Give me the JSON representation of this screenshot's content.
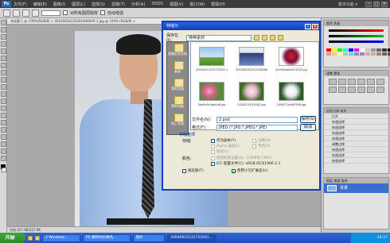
{
  "menubar": {
    "logo": "Ps",
    "items": [
      "文件(F)",
      "编辑(E)",
      "图像(I)",
      "图层(L)",
      "选择(S)",
      "滤镜(T)",
      "分析(A)",
      "3D(D)",
      "视图(V)",
      "窗口(W)",
      "帮助(H)"
    ],
    "workspace": "基本功能 ▾",
    "min": "–",
    "max": "□",
    "close": "×"
  },
  "optbar": {
    "check1_label": "对所有图层取样",
    "check2_label": "自动增强"
  },
  "document": {
    "tab_title": "未标题-1 @ 100%(RGB/8) ×  20030818132201646640-1.jpg @ 100% (RGB/8) ×"
  },
  "statusbar": {
    "text": "文档:327.9K/327.9K"
  },
  "panels": {
    "color_title": "颜色  色板",
    "adjust_title": "调整  蒙版",
    "history_title": "历史记录  动作",
    "history_items": [
      "打开",
      "快速选择",
      "快速选择",
      "快速选择",
      "快速选择",
      "调整边缘",
      "快速选择",
      "快速选择",
      "快速选择"
    ],
    "layers_title": "图层  通道  路径",
    "layer_name": "背景",
    "swatch_colors": [
      "#ff0000",
      "#ffff00",
      "#00ff00",
      "#00ffff",
      "#0000ff",
      "#ff00ff",
      "#ffffff",
      "#cccccc",
      "#999999",
      "#666666",
      "#333333",
      "#000000",
      "#f7977a",
      "#fdc68a",
      "#fff79a",
      "#a2d39c",
      "#6dcff6",
      "#8493ca",
      "#a187be",
      "#f49ac2",
      "#c7b299",
      "#998675",
      "#736357",
      "#534741"
    ]
  },
  "dialog": {
    "title": "存储为",
    "help": "?",
    "close": "×",
    "save_in_label": "保存在(I):",
    "save_in_value": "特种素材",
    "places": [
      "我最近的文档",
      "桌面",
      "我的文档",
      "我的电脑",
      "网上邻居"
    ],
    "files": [
      "20040910135752041.jpg",
      "20030818132201646640-1.jpg",
      "42a93cb6dd1f1020.jpg",
      "3ba5b9c4ea0d8.jpg",
      "2004101813482.jpg",
      "2094f71ea8f7f98.jpg"
    ],
    "filename_label": "文件名(N):",
    "filename_value": "2.psd",
    "format_label": "格式(F):",
    "format_value": "JPEG (*.JPG;*.JPEG;*.JPE)",
    "save_button": "保存(S)",
    "cancel_button": "取消",
    "options_header": "存储选项",
    "save_group": "存储:",
    "opt_copy": "作为副本(Y)",
    "opt_notes": "注释(N)",
    "opt_alpha": "Alpha 通道(E)",
    "opt_spot": "专色(P)",
    "opt_layers": "图层(L)",
    "color_group": "颜色:",
    "opt_proof": "使用校样设置(O): 工作中的 CMYK",
    "opt_icc": "ICC 配置文件(C): sRGB IEC61966-2.1",
    "opt_thumb": "缩览图(T)",
    "opt_ext": "使用小写扩展名(U)",
    "warning": ""
  },
  "taskbar": {
    "start": "开始",
    "tasks": [
      "2 Windows...",
      "PS 模特衬衫换色...",
      "图片",
      "20040910135752041..."
    ],
    "clock": "14:27"
  }
}
